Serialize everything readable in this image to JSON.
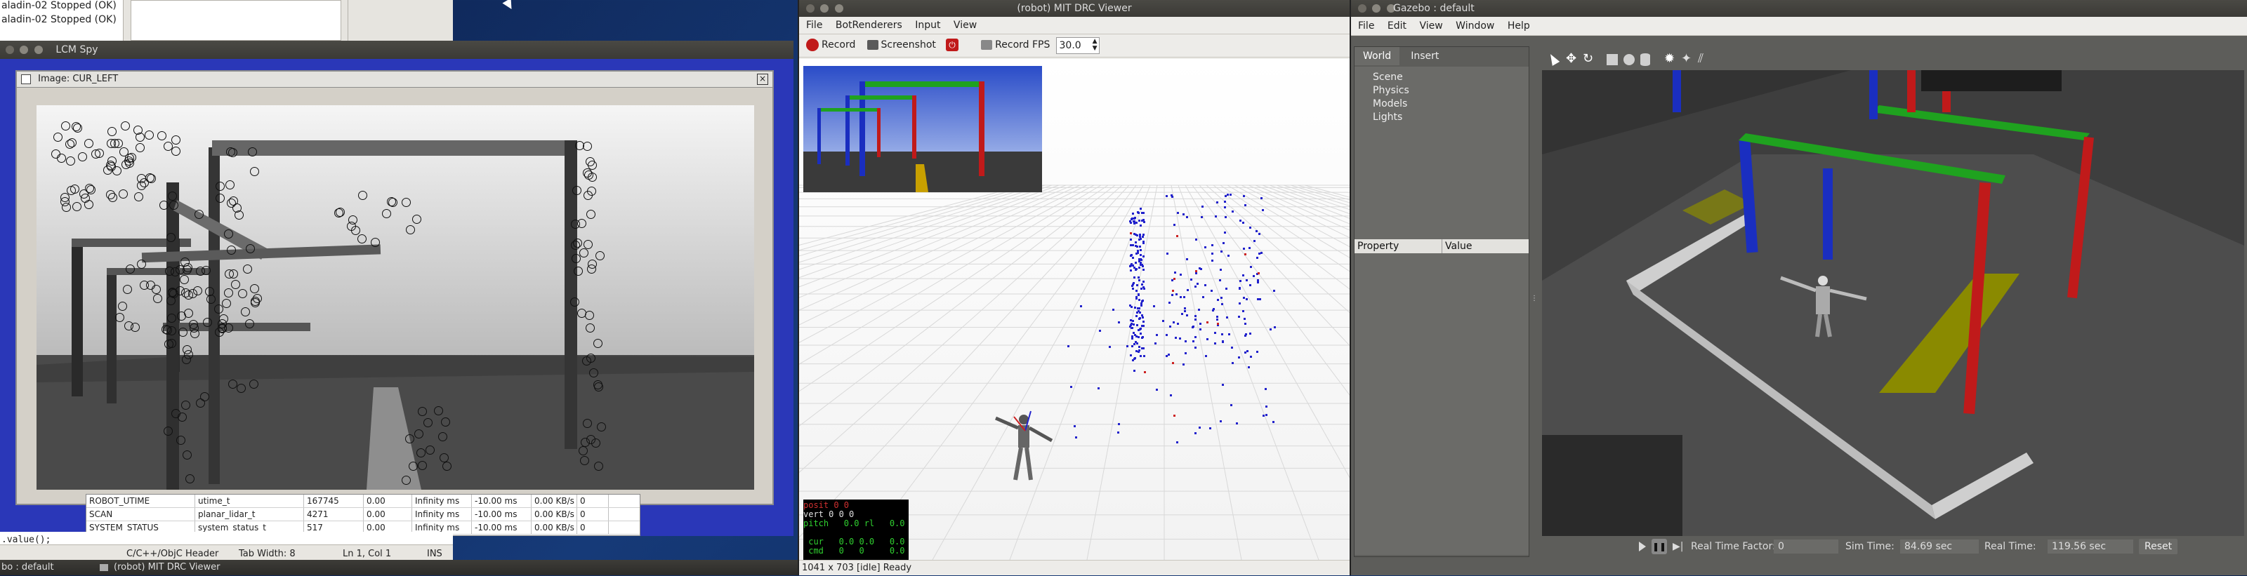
{
  "background_windows": {
    "list_lines": [
      "aladin-02 Stopped (OK)",
      "aladin-02 Stopped (OK)"
    ],
    "editor_status": {
      "language": "C/C++/ObjC Header",
      "tab_width": "Tab Width: 8",
      "position": "Ln 1, Col 1",
      "mode": "INS"
    },
    "code_fragment": ".value();"
  },
  "taskbar": {
    "items": [
      "bo : default",
      "(robot) MIT DRC Viewer"
    ]
  },
  "lcm_spy": {
    "title": "LCM Spy",
    "image_window_title": "Image: CUR_LEFT",
    "table_rows": [
      [
        "ROBOT_UTIME",
        "utime_t",
        "167745",
        "0.00",
        "Infinity ms",
        "-10.00 ms",
        "0.00 KB/s",
        "0"
      ],
      [
        "SCAN",
        "planar_lidar_t",
        "4271",
        "0.00",
        "Infinity ms",
        "-10.00 ms",
        "0.00 KB/s",
        "0"
      ],
      [
        "SYSTEM_STATUS",
        "system_status_t",
        "517",
        "0.00",
        "Infinity ms",
        "-10.00 ms",
        "0.00 KB/s",
        "0"
      ]
    ]
  },
  "drc_viewer": {
    "title": "(robot) MIT DRC Viewer",
    "menu": [
      "File",
      "BotRenderers",
      "Input",
      "View"
    ],
    "toolbar": {
      "record": "Record",
      "screenshot": "Screenshot",
      "record_fps_label": "Record FPS",
      "record_fps_value": "30.0"
    },
    "status": "1041 x 703 [idle] Ready",
    "terminal_lines": [
      {
        "text": "posit 0 0",
        "color": "#d03030"
      },
      {
        "text": "vert 0 0 0",
        "color": "#e0e0e0"
      },
      {
        "text": "pitch   0.0 rl   0.0",
        "color": "#30d030"
      },
      {
        "text": "",
        "color": "#e0e0e0"
      },
      {
        "text": " cur   0.0 0.0   0.0",
        "color": "#30d030"
      },
      {
        "text": " cmd   0   0     0.0",
        "color": "#30d030"
      }
    ]
  },
  "gazebo": {
    "title": "Gazebo : default",
    "menu": [
      "File",
      "Edit",
      "View",
      "Window",
      "Help"
    ],
    "tabs": [
      "World",
      "Insert"
    ],
    "tree": [
      "Scene",
      "Physics",
      "Models",
      "Lights"
    ],
    "property_header": [
      "Property",
      "Value"
    ],
    "bottom": {
      "rtf_label": "Real Time Factor:",
      "rtf_value": "0",
      "sim_time_label": "Sim Time:",
      "sim_time_value": "84.69 sec",
      "real_time_label": "Real Time:",
      "real_time_value": "119.56 sec",
      "reset": "Reset"
    }
  },
  "colors": {
    "record_red": "#c01a1a",
    "gazebo_panel": "#5d5d5a",
    "point_blue": "#2222cc",
    "point_red": "#cc2222"
  }
}
